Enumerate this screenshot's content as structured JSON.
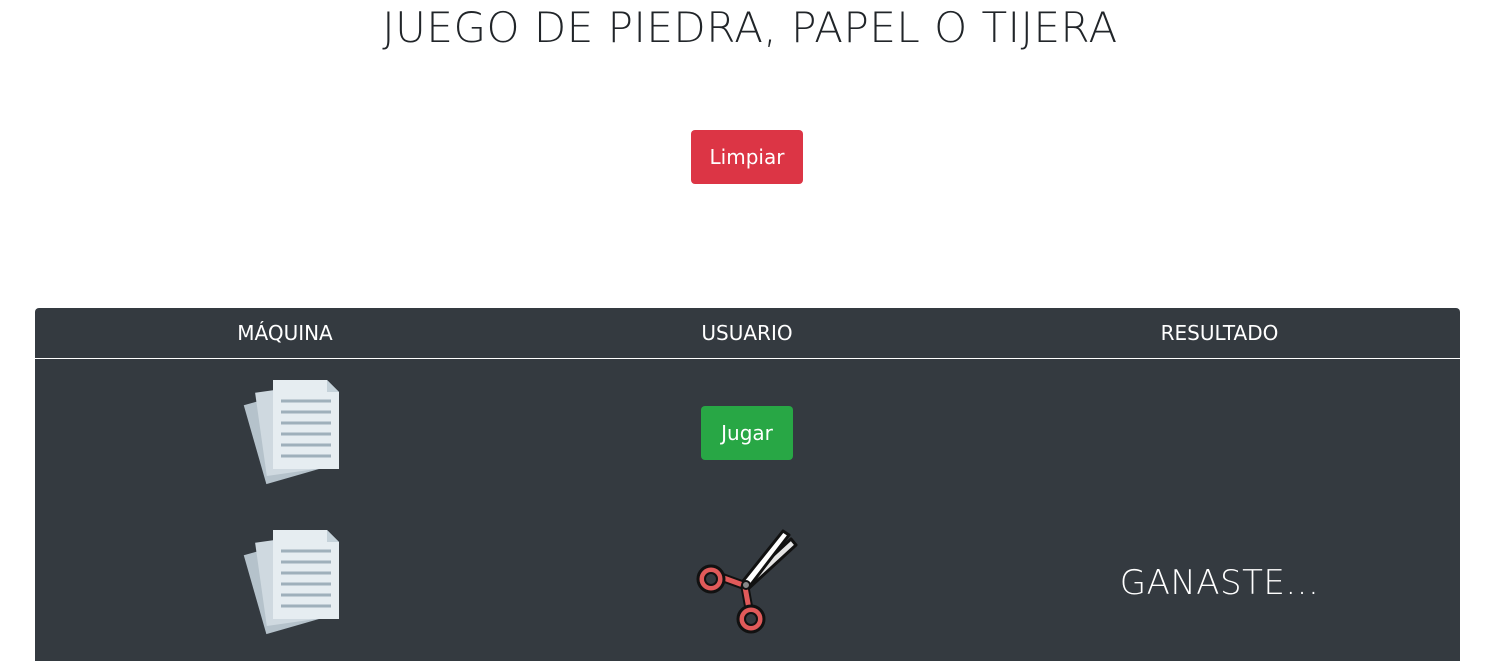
{
  "header": {
    "title": "JUEGO DE PIEDRA, PAPEL O TIJERA"
  },
  "controls": {
    "clear_label": "Limpiar"
  },
  "table": {
    "columns": [
      "MÁQUINA",
      "USUARIO",
      "RESULTADO"
    ],
    "rows": [
      {
        "machine_icon": "paper-icon",
        "user_action": "Jugar",
        "result": ""
      },
      {
        "machine_icon": "paper-icon",
        "user_icon": "scissors-icon",
        "result": "GANASTE..."
      }
    ]
  },
  "colors": {
    "danger": "#dc3545",
    "success": "#28a745",
    "table_bg": "#343a40"
  }
}
